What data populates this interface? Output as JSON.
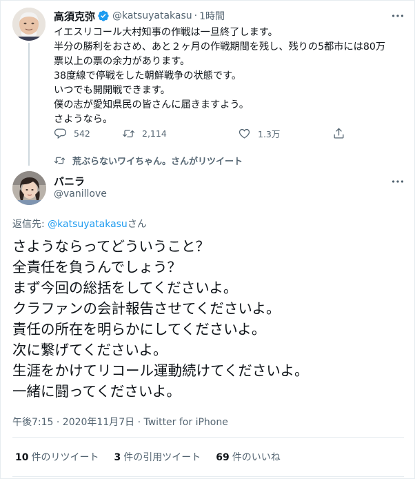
{
  "parent_tweet": {
    "author_name": "高須克弥",
    "handle": "@katsuyatakasu",
    "separator": "·",
    "time": "1時間",
    "verified": true,
    "lines": [
      "イエスリコール大村知事の作戦は一旦終了します。",
      "半分の勝利をおさめ、あと２ヶ月の作戦期間を残し、残りの5都市には80万",
      "票以上の票の余力があります。",
      "38度線で停戦をした朝鮮戦争の状態です。",
      "いつでも開開戦できます。",
      "僕の志が愛知県民の皆さんに届きますよう。",
      "さようなら。"
    ],
    "replies": "542",
    "retweets": "2,114",
    "likes": "1.3万",
    "icons": [
      "reply-icon",
      "retweet-icon",
      "like-icon",
      "share-icon",
      "more-icon",
      "verified-badge-icon"
    ]
  },
  "retweet_notice": "荒ぶらないワイちゃん。さんがリツイート",
  "main_tweet": {
    "author_name": "バニラ",
    "handle": "@vanillove",
    "reply_to_prefix": "返信先: ",
    "reply_to_mention": "@katsuyatakasu",
    "reply_to_suffix": "さん",
    "lines": [
      "さようならってどういうこと？",
      "全責任を負うんでしょう？",
      "まず今回の総括をしてくださいよ。",
      "クラファンの会計報告させてくださいよ。",
      "責任の所在を明らかにしてくださいよ。",
      "次に繋げてくださいよ。",
      "生涯をかけてリコール運動続けてくださいよ。",
      "一緒に闘ってくださいよ。"
    ],
    "timestamp": "午後7:15 · 2020年11月7日 · ",
    "source": "Twitter for iPhone",
    "stats": {
      "retweets_count": "10",
      "retweets_label": "件のリツイート",
      "quotes_count": "3",
      "quotes_label": "件の引用ツイート",
      "likes_count": "69",
      "likes_label": "件のいいね"
    }
  },
  "colors": {
    "text": "#0f1419",
    "secondary": "#536471",
    "accent": "#1d9bf0",
    "border": "#e6ecf0"
  }
}
